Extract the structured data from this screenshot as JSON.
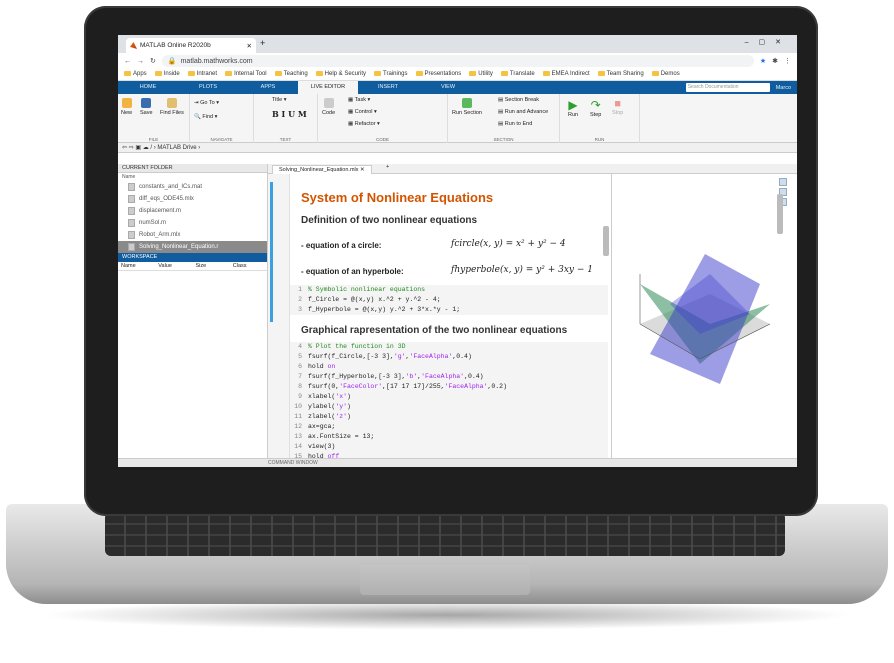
{
  "browser": {
    "tab_title": "MATLAB Online R2020b",
    "url": "matlab.mathworks.com",
    "bookmarks": [
      "Apps",
      "Inside",
      "Intranet",
      "Internal Tool",
      "Teaching",
      "Help & Security",
      "Trainings",
      "Presentations",
      "Utility",
      "Translate",
      "EMEA Indirect",
      "Team Sharing",
      "Demos"
    ]
  },
  "toolstrip": {
    "tabs": [
      "HOME",
      "PLOTS",
      "APPS",
      "LIVE EDITOR",
      "INSERT",
      "VIEW"
    ],
    "search_placeholder": "Search Documentation",
    "user": "Marco",
    "sections": {
      "file": {
        "label": "FILE",
        "new": "New",
        "save": "Save",
        "find_files": "Find Files"
      },
      "navigate": {
        "label": "NAVIGATE",
        "goto": "Go To",
        "find": "Find"
      },
      "text": {
        "label": "TEXT",
        "title": "Title"
      },
      "code": {
        "label": "CODE",
        "code": "Code",
        "task": "Task",
        "control": "Control",
        "refactor": "Refactor"
      },
      "section": {
        "label": "SECTION",
        "run_section": "Run Section",
        "section_break": "Section Break",
        "run_and_advance": "Run and Advance",
        "run_to_end": "Run to End"
      },
      "run": {
        "label": "RUN",
        "run": "Run",
        "step": "Step",
        "stop": "Stop"
      }
    }
  },
  "path": "MATLAB Drive",
  "current_folder": {
    "header": "CURRENT FOLDER",
    "column": "Name",
    "files": [
      "constants_and_ICs.mat",
      "diff_eqs_ODE45.mlx",
      "displacement.m",
      "numSol.m",
      "Robot_Arm.mlx",
      "Solving_Nonlinear_Equation.r"
    ]
  },
  "workspace": {
    "header": "WORKSPACE",
    "columns": [
      "Name",
      "Value",
      "Size",
      "Class"
    ]
  },
  "editor": {
    "tab": "Solving_Nonlinear_Equation.mlx",
    "title": "System of Nonlinear Equations",
    "h_def": "Definition of two nonlinear equations",
    "eq1_label": "- equation of a circle:",
    "eq1_math": "fcircle(x, y) = x² + y² − 4",
    "eq2_label": "- equation of an hyperbole:",
    "eq2_math": "fhyperbole(x, y) = y² + 3xy − 1",
    "h_graph": "Graphical rapresentation of the two nonlinear equations"
  },
  "status": {
    "command_window": "COMMAND WINDOW"
  },
  "plot": {
    "colors": {
      "circle": "#2e8b57",
      "hyperbole": "#3b3bcc",
      "plane": "#777777"
    }
  }
}
